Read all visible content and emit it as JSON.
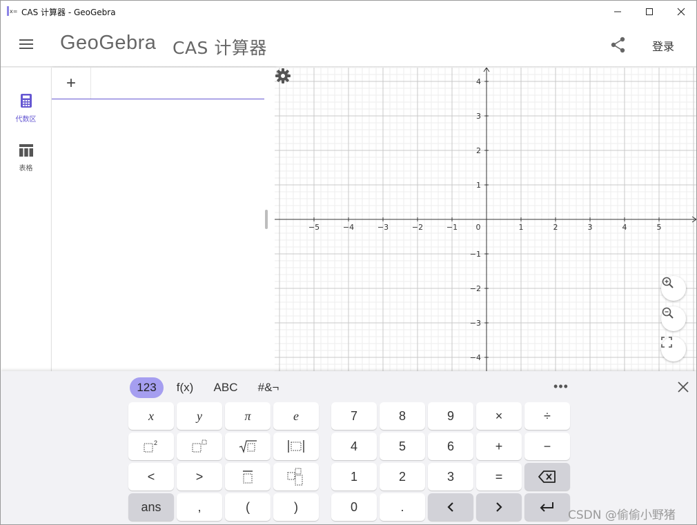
{
  "window": {
    "title": "CAS 计算器 - GeoGebra",
    "app_icon_text": "x="
  },
  "header": {
    "logo": "GeoGebra",
    "subtitle": "CAS 计算器",
    "login_label": "登录"
  },
  "sidenav": {
    "items": [
      {
        "label": "代数区",
        "icon": "calculator-icon",
        "active": true
      },
      {
        "label": "表格",
        "icon": "table-icon",
        "active": false
      }
    ]
  },
  "algebra": {
    "add_label": "+"
  },
  "graphics": {
    "x_ticks": [
      "−5",
      "−4",
      "−3",
      "−2",
      "−1",
      "0",
      "1",
      "2",
      "3",
      "4",
      "5"
    ],
    "y_ticks": [
      "4",
      "3",
      "2",
      "1",
      "−1",
      "−2",
      "−3",
      "−4"
    ],
    "origin_label": "0"
  },
  "keyboard": {
    "tabs": [
      "123",
      "f(x)",
      "ABC",
      "#&¬"
    ],
    "active_tab": "123",
    "more_label": "•••",
    "left_keys": [
      [
        "x",
        "y",
        "π",
        "e"
      ],
      [
        "□²",
        "□ⁿ",
        "√□",
        "|□|"
      ],
      [
        "<",
        ">",
        "□⁄□",
        "□□"
      ],
      [
        "ans",
        ",",
        "(",
        ")"
      ]
    ],
    "right_keys": [
      [
        "7",
        "8",
        "9",
        "×",
        "÷"
      ],
      [
        "4",
        "5",
        "6",
        "+",
        "−"
      ],
      [
        "1",
        "2",
        "3",
        "=",
        "backspace"
      ],
      [
        "0",
        ".",
        "left",
        "right",
        "enter"
      ]
    ]
  },
  "colors": {
    "accent": "#6557d2",
    "active_tab": "#a59ef0",
    "keyboard_bg": "#f2f2f5",
    "gray_key": "#d2d2d8"
  },
  "watermark": "CSDN @偷偷小野猪"
}
